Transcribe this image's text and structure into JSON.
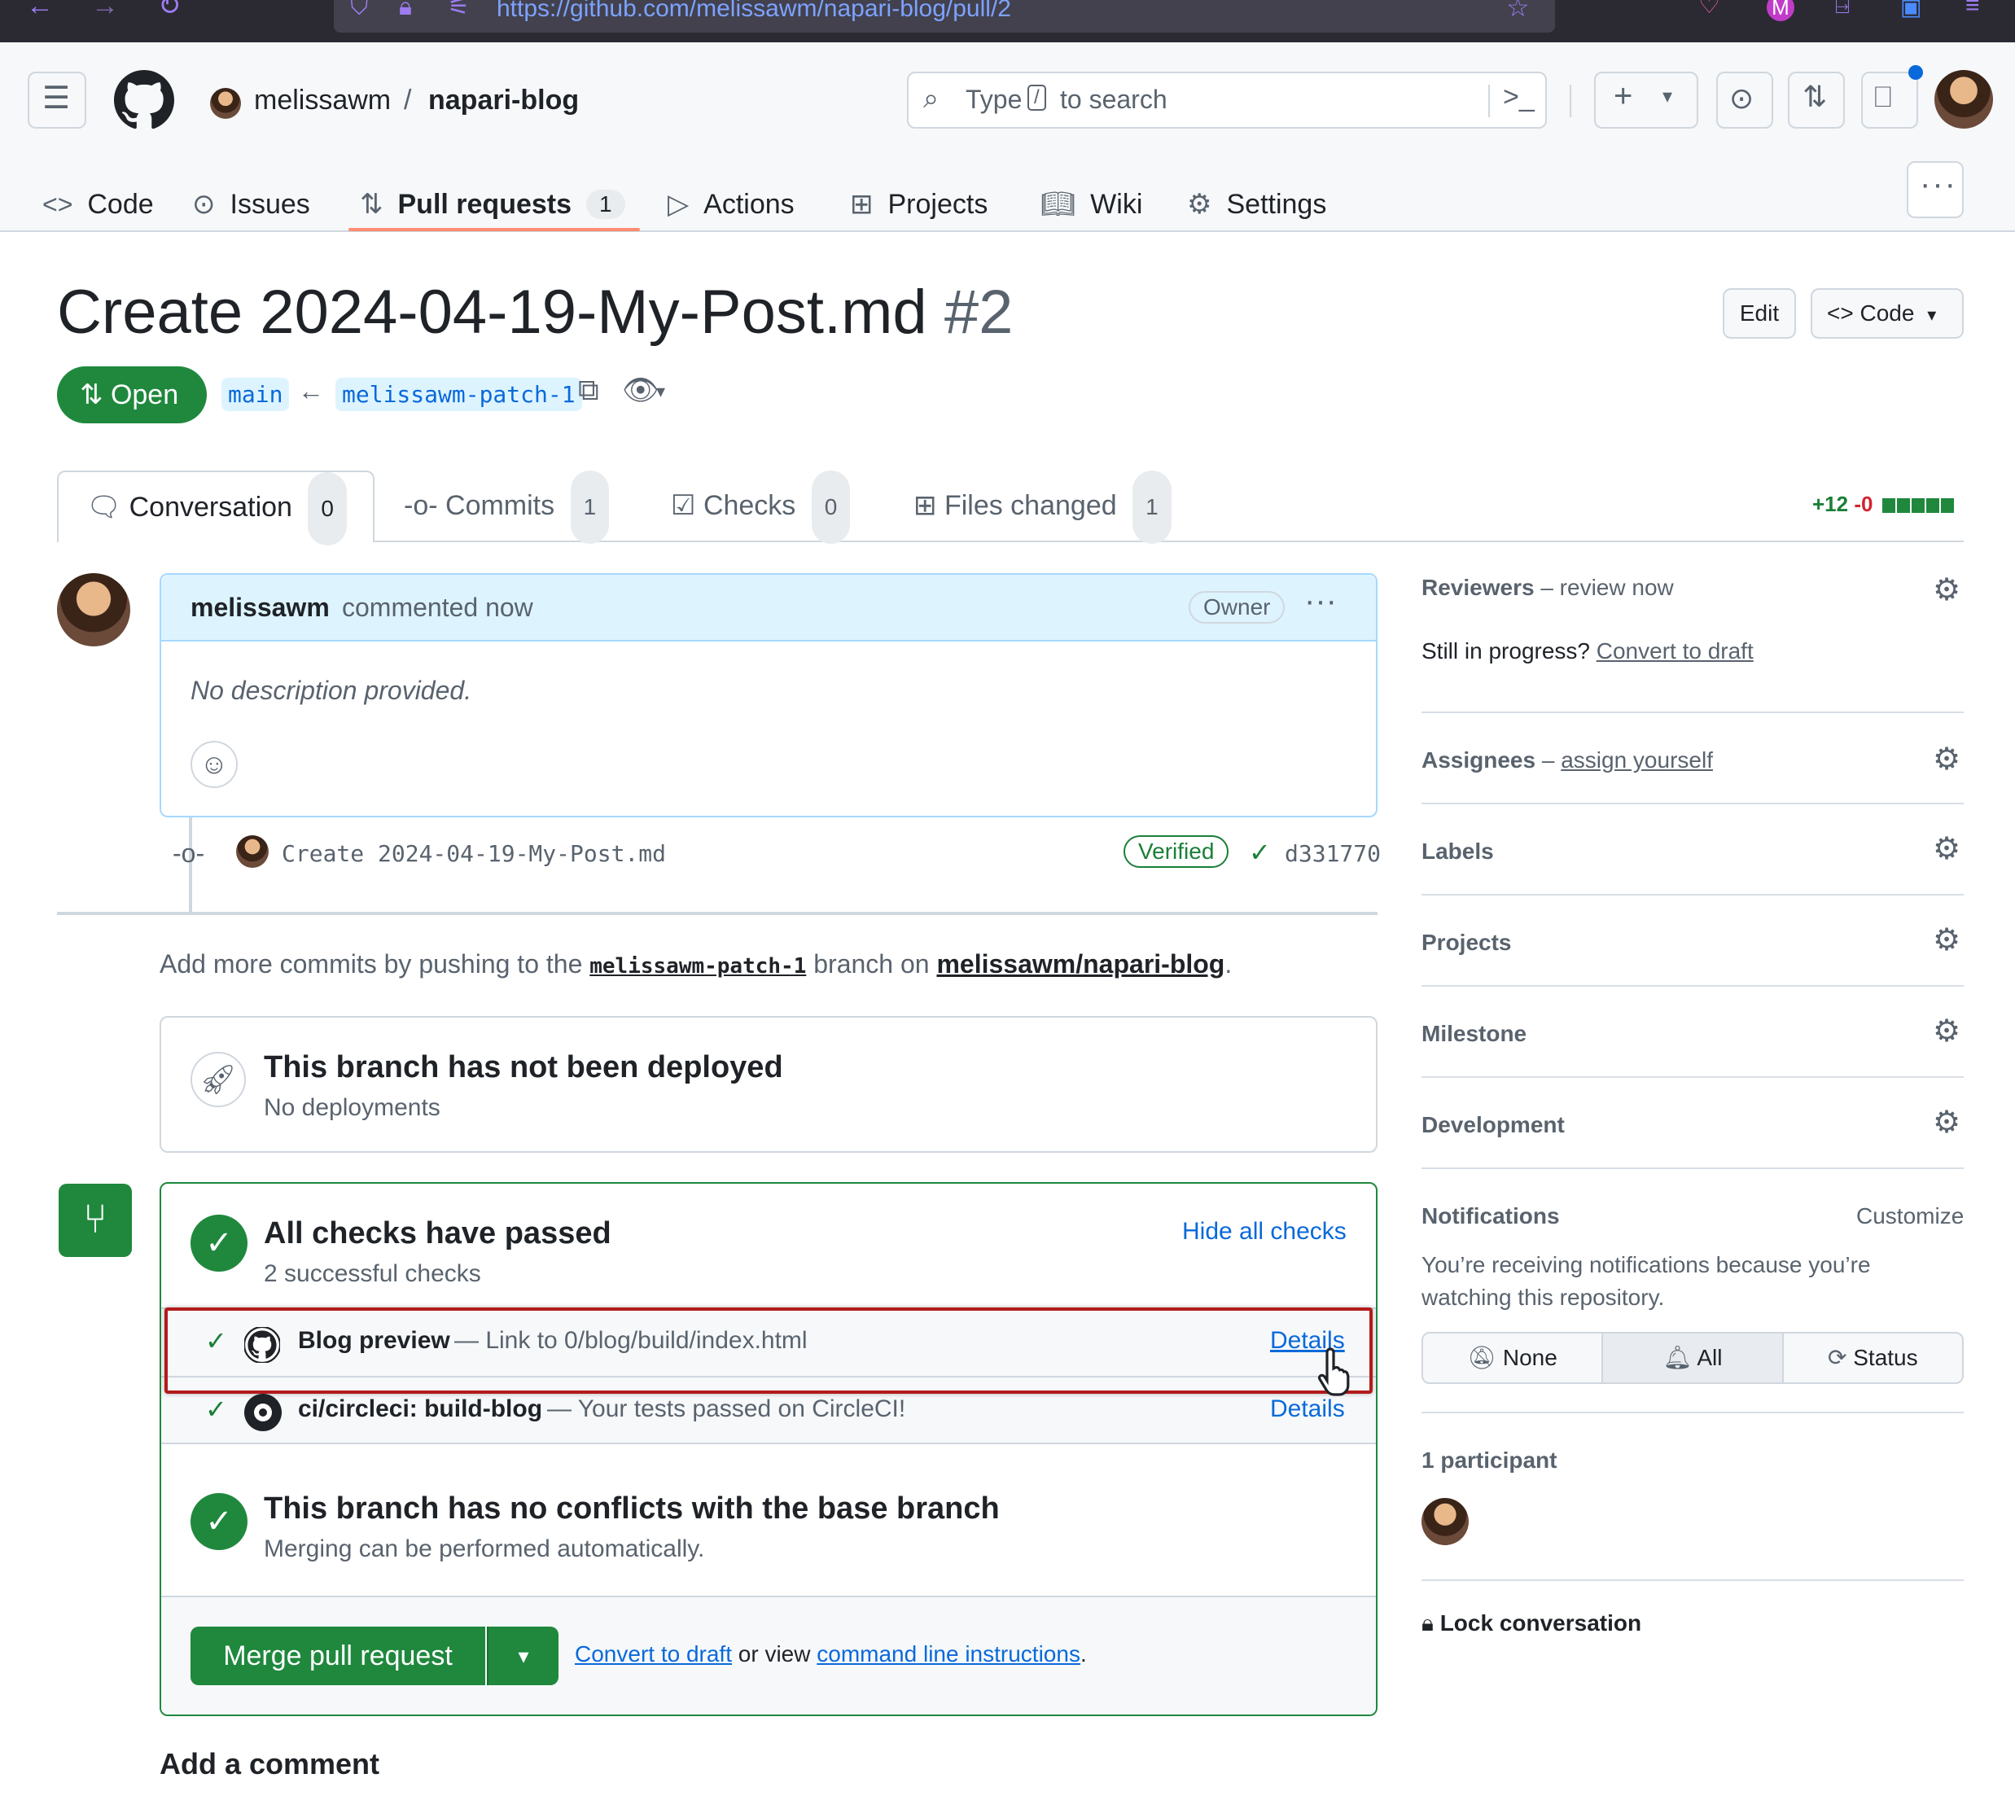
{
  "browser": {
    "url": "https://github.com/melissawm/napari-blog/pull/2"
  },
  "header": {
    "owner": "melissawm",
    "separator": "/",
    "repo": "napari-blog",
    "search_prefix": "Type",
    "search_key": "/",
    "search_suffix": "to search"
  },
  "repo_tabs": [
    {
      "label": "Code"
    },
    {
      "label": "Issues"
    },
    {
      "label": "Pull requests",
      "count": "1"
    },
    {
      "label": "Actions"
    },
    {
      "label": "Projects"
    },
    {
      "label": "Wiki"
    },
    {
      "label": "Settings"
    }
  ],
  "pr": {
    "title": "Create 2024-04-19-My-Post.md",
    "number": "#2",
    "edit_label": "Edit",
    "code_label": "Code",
    "state": "Open",
    "base_branch": "main",
    "head_branch": "melissawm-patch-1"
  },
  "pr_tabs": [
    {
      "label": "Conversation",
      "count": "0"
    },
    {
      "label": "Commits",
      "count": "1"
    },
    {
      "label": "Checks",
      "count": "0"
    },
    {
      "label": "Files changed",
      "count": "1"
    }
  ],
  "diffstat": {
    "added": "+12",
    "removed": "-0"
  },
  "comment": {
    "author": "melissawm",
    "action": "commented now",
    "badge": "Owner",
    "body": "No description provided."
  },
  "commit": {
    "message": "Create 2024-04-19-My-Post.md",
    "verified": "Verified",
    "sha": "d331770"
  },
  "push_hint": {
    "prefix": "Add more commits by pushing to the",
    "branch": "melissawm-patch-1",
    "middle": "branch on",
    "repo": "melissawm/napari-blog",
    "suffix": "."
  },
  "deploy": {
    "title": "This branch has not been deployed",
    "subtitle": "No deployments"
  },
  "checks": {
    "title": "All checks have passed",
    "subtitle": "2 successful checks",
    "hide_label": "Hide all checks",
    "items": [
      {
        "name": "Blog preview",
        "desc": "— Link to 0/blog/build/index.html",
        "details": "Details"
      },
      {
        "name": "ci/circleci: build-blog",
        "desc": "— Your tests passed on CircleCI!",
        "details": "Details"
      }
    ]
  },
  "conflicts": {
    "title": "This branch has no conflicts with the base branch",
    "subtitle": "Merging can be performed automatically."
  },
  "merge": {
    "button": "Merge pull request",
    "convert": "Convert to draft",
    "middle": "or view",
    "cli": "command line instructions",
    "suffix": "."
  },
  "add_comment": "Add a comment",
  "sidebar": {
    "reviewers_label": "Reviewers",
    "reviewers_action": "– review now",
    "in_progress": "Still in progress?",
    "convert_draft": "Convert to draft",
    "assignees_label": "Assignees",
    "assignees_dash": "–",
    "assignees_action": "assign yourself",
    "labels": "Labels",
    "projects": "Projects",
    "milestone": "Milestone",
    "development": "Development",
    "notifications": "Notifications",
    "customize": "Customize",
    "notif_text": "You’re receiving notifications because you’re watching this repository.",
    "notif_options": [
      "None",
      "All",
      "Status"
    ],
    "participants": "1 participant",
    "lock": "Lock conversation"
  },
  "colors": {
    "accent_green": "#1f883d",
    "link_blue": "#0969da",
    "tab_underline": "#fd8c73",
    "highlight_red": "#b31b1b"
  }
}
